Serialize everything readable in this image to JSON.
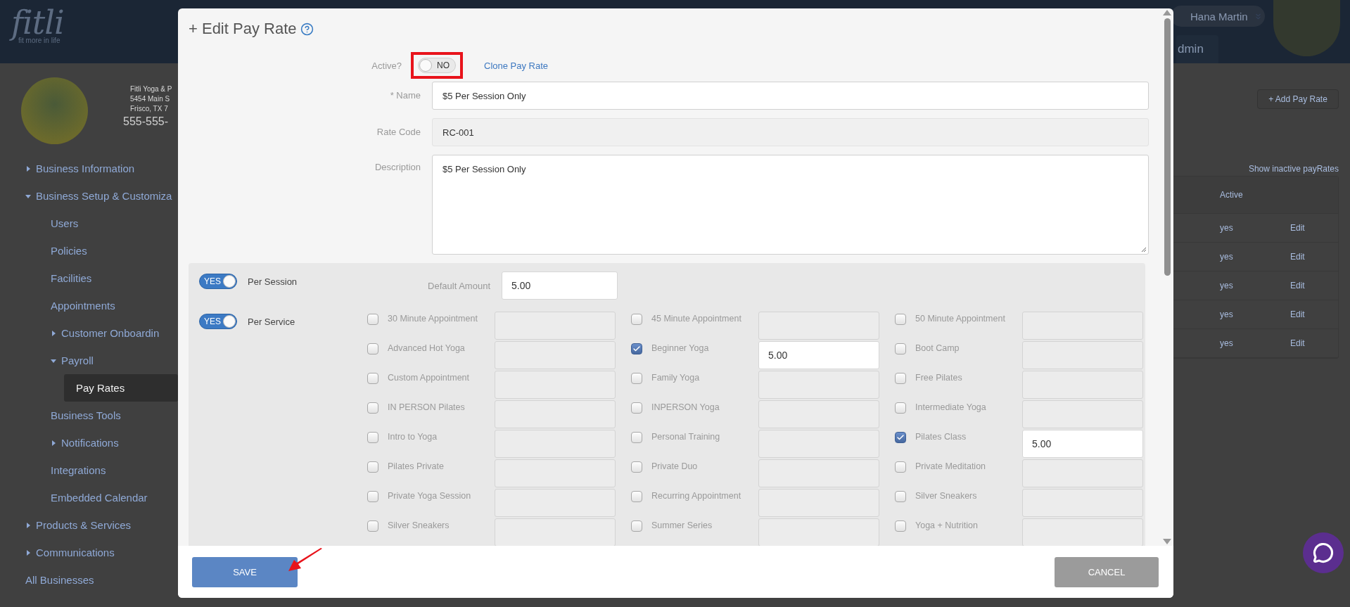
{
  "header": {
    "logo_text": "fitli",
    "tagline": "fit more in life",
    "user_name": "Hana Martin",
    "nav_tab": "dmin"
  },
  "business": {
    "lines": [
      "Fitli Yoga & P",
      "5454 Main S",
      "Frisco, TX 7"
    ],
    "phone": "555-555-"
  },
  "sidebar": {
    "items": [
      {
        "label": "Business Information",
        "kind": "folder",
        "expanded": false,
        "selected": false
      },
      {
        "label": "Business Setup & Customiza",
        "kind": "folder",
        "expanded": true,
        "selected": false,
        "children": [
          {
            "label": "Users",
            "kind": "link",
            "selected": false
          },
          {
            "label": "Policies",
            "kind": "link",
            "selected": false
          },
          {
            "label": "Facilities",
            "kind": "link",
            "selected": false
          },
          {
            "label": "Appointments",
            "kind": "link",
            "selected": false
          },
          {
            "label": "Customer Onboardin",
            "kind": "folder",
            "expanded": false,
            "selected": false
          },
          {
            "label": "Payroll",
            "kind": "folder",
            "expanded": true,
            "selected": false,
            "children": [
              {
                "label": "Pay Rates",
                "kind": "link",
                "selected": true
              }
            ]
          },
          {
            "label": "Business Tools",
            "kind": "link",
            "selected": false
          },
          {
            "label": "Notifications",
            "kind": "folder",
            "expanded": false,
            "selected": false
          },
          {
            "label": "Integrations",
            "kind": "link",
            "selected": false
          },
          {
            "label": "Embedded Calendar",
            "kind": "link",
            "selected": false
          }
        ]
      },
      {
        "label": "Products & Services",
        "kind": "folder",
        "expanded": false,
        "selected": false
      },
      {
        "label": "Communications",
        "kind": "folder",
        "expanded": false,
        "selected": false
      },
      {
        "label": "All Businesses",
        "kind": "link",
        "selected": false
      }
    ]
  },
  "content": {
    "add_button": "+ Add Pay Rate",
    "show_inactive": "Show inactive payRates",
    "table": {
      "columns": [
        "Active"
      ],
      "rows": [
        {
          "active": "yes",
          "action": "Edit"
        },
        {
          "active": "yes",
          "action": "Edit"
        },
        {
          "active": "yes",
          "action": "Edit"
        },
        {
          "active": "yes",
          "action": "Edit"
        },
        {
          "active": "yes",
          "action": "Edit"
        }
      ]
    }
  },
  "modal": {
    "title": "+ Edit Pay Rate",
    "active": {
      "label": "Active?",
      "text": "NO",
      "on": false
    },
    "clone_link": "Clone Pay Rate",
    "fields": [
      {
        "label": "* Name",
        "value": "$5 Per Session Only",
        "kind": "input"
      },
      {
        "label": "Rate Code",
        "value": "RC-001",
        "kind": "readonly"
      },
      {
        "label": "Description",
        "value": "$5 Per Session Only",
        "kind": "textarea"
      }
    ],
    "rate_options": [
      {
        "label": "Per Session",
        "text": "YES",
        "on": true
      },
      {
        "label": "Per Service",
        "text": "YES",
        "on": true
      }
    ],
    "default_amount": {
      "label": "Default Amount",
      "value": "5.00"
    },
    "services": [
      {
        "label": "30 Minute Appointment",
        "checked": false
      },
      {
        "label": "45 Minute Appointment",
        "checked": false
      },
      {
        "label": "50 Minute Appointment",
        "checked": false
      },
      {
        "label": "Advanced Hot Yoga",
        "checked": false
      },
      {
        "label": "Beginner Yoga",
        "checked": true,
        "amount": "5.00"
      },
      {
        "label": "Boot Camp",
        "checked": false
      },
      {
        "label": "Custom Appointment",
        "checked": false
      },
      {
        "label": "Family Yoga",
        "checked": false
      },
      {
        "label": "Free Pilates",
        "checked": false
      },
      {
        "label": "IN PERSON Pilates",
        "checked": false
      },
      {
        "label": "INPERSON Yoga",
        "checked": false
      },
      {
        "label": "Intermediate Yoga",
        "checked": false
      },
      {
        "label": "Intro to Yoga",
        "checked": false
      },
      {
        "label": "Personal Training",
        "checked": false
      },
      {
        "label": "Pilates Class",
        "checked": true,
        "amount": "5.00"
      },
      {
        "label": "Pilates Private",
        "checked": false
      },
      {
        "label": "Private Duo",
        "checked": false
      },
      {
        "label": "Private Meditation",
        "checked": false
      },
      {
        "label": "Private Yoga Session",
        "checked": false
      },
      {
        "label": "Recurring Appointment",
        "checked": false
      },
      {
        "label": "Silver Sneakers",
        "checked": false
      },
      {
        "label": "Silver Sneakers",
        "checked": false
      },
      {
        "label": "Summer Series",
        "checked": false
      },
      {
        "label": "Yoga + Nutrition",
        "checked": false
      }
    ],
    "buttons": {
      "save": "SAVE",
      "cancel": "CANCEL"
    }
  }
}
